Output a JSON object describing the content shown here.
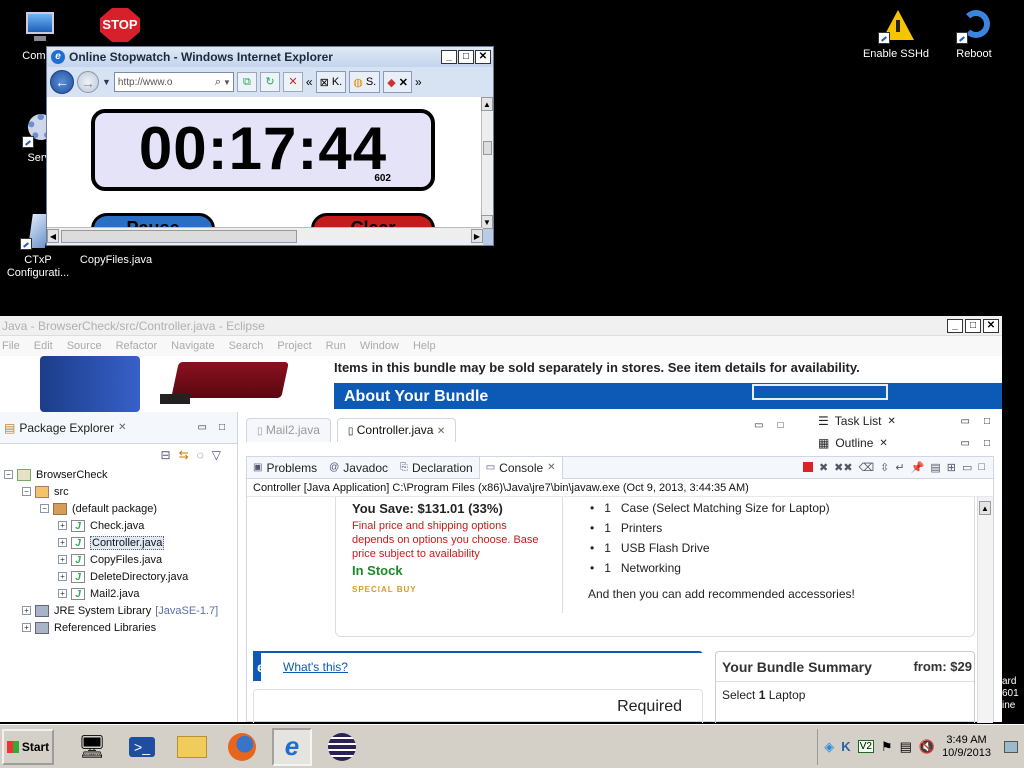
{
  "desktop": {
    "icons": [
      {
        "label": "Compu"
      },
      {
        "label": "Servi"
      },
      {
        "label": "CTxP Configurati..."
      },
      {
        "label": "CopyFiles.java"
      },
      {
        "label": "Enable SSHd"
      },
      {
        "label": "Reboot"
      }
    ]
  },
  "ie": {
    "title": "Online Stopwatch - Windows Internet Explorer",
    "address": "http://www.o",
    "tab_labels": [
      "K.",
      "S."
    ],
    "stopwatch_time": "00:17:44",
    "stopwatch_ms": "602",
    "pause_label": "Pause",
    "clear_label": "Clear"
  },
  "eclipse": {
    "title": "Java - BrowserCheck/src/Controller.java - Eclipse",
    "menu": [
      "File",
      "Edit",
      "Source",
      "Refactor",
      "Navigate",
      "Search",
      "Project",
      "Run",
      "Window",
      "Help"
    ],
    "web_strip": {
      "bundle_note": "Items in this bundle may be sold separately in stores. See item details for availability.",
      "about_title": "About Your Bundle"
    },
    "package_explorer": {
      "title": "Package Explorer",
      "tree": [
        {
          "label": "BrowserCheck",
          "level": 0,
          "toggle": "−",
          "icon": "proj"
        },
        {
          "label": "src",
          "level": 1,
          "toggle": "−",
          "icon": "src"
        },
        {
          "label": "(default package)",
          "level": 2,
          "toggle": "−",
          "icon": "pkgi"
        },
        {
          "label": "Check.java",
          "level": 3,
          "toggle": "+",
          "icon": "java"
        },
        {
          "label": "Controller.java",
          "level": 3,
          "toggle": "+",
          "icon": "java",
          "selected": true
        },
        {
          "label": "CopyFiles.java",
          "level": 3,
          "toggle": "+",
          "icon": "java"
        },
        {
          "label": "DeleteDirectory.java",
          "level": 3,
          "toggle": "+",
          "icon": "java"
        },
        {
          "label": "Mail2.java",
          "level": 3,
          "toggle": "+",
          "icon": "java"
        },
        {
          "label": "JRE System Library",
          "level": 1,
          "toggle": "+",
          "icon": "lib",
          "extra": "[JavaSE-1.7]"
        },
        {
          "label": "Referenced Libraries",
          "level": 1,
          "toggle": "+",
          "icon": "lib"
        }
      ]
    },
    "editor_tabs": [
      "Mail2.java",
      "Controller.java"
    ],
    "side_views": [
      "Task List",
      "Outline"
    ],
    "console": {
      "tabs": [
        "Problems",
        "Javadoc",
        "Declaration",
        "Console"
      ],
      "description": "Controller [Java Application] C:\\Program Files (x86)\\Java\\jre7\\bin\\javaw.exe (Oct 9, 2013, 3:44:35 AM)"
    },
    "web_content": {
      "you_save": "You Save: $131.01 (33%)",
      "price_note": "Final price and shipping options depends on options you choose. Base price subject to availability",
      "in_stock": "In Stock",
      "special_buy": "SPECIAL BUY",
      "bundle_items": [
        {
          "qty": "1",
          "name": "Case (Select Matching Size for Laptop)"
        },
        {
          "qty": "1",
          "name": "Printers"
        },
        {
          "qty": "1",
          "name": "USB Flash Drive"
        },
        {
          "qty": "1",
          "name": "Networking"
        }
      ],
      "then_add": "And then you can add recommended accessories!",
      "whats_this": "What's this?",
      "whats_prefix": "e",
      "required": "Required",
      "summary_title": "Your Bundle Summary",
      "summary_from": "from: $29",
      "summary_select_prefix": "Select",
      "summary_select_qty": "1",
      "summary_select_item": "Laptop"
    }
  },
  "right_edge_text": [
    "ard",
    "601",
    "ine"
  ],
  "taskbar": {
    "start_label": "Start",
    "clock_time": "3:49 AM",
    "clock_date": "10/9/2013"
  }
}
